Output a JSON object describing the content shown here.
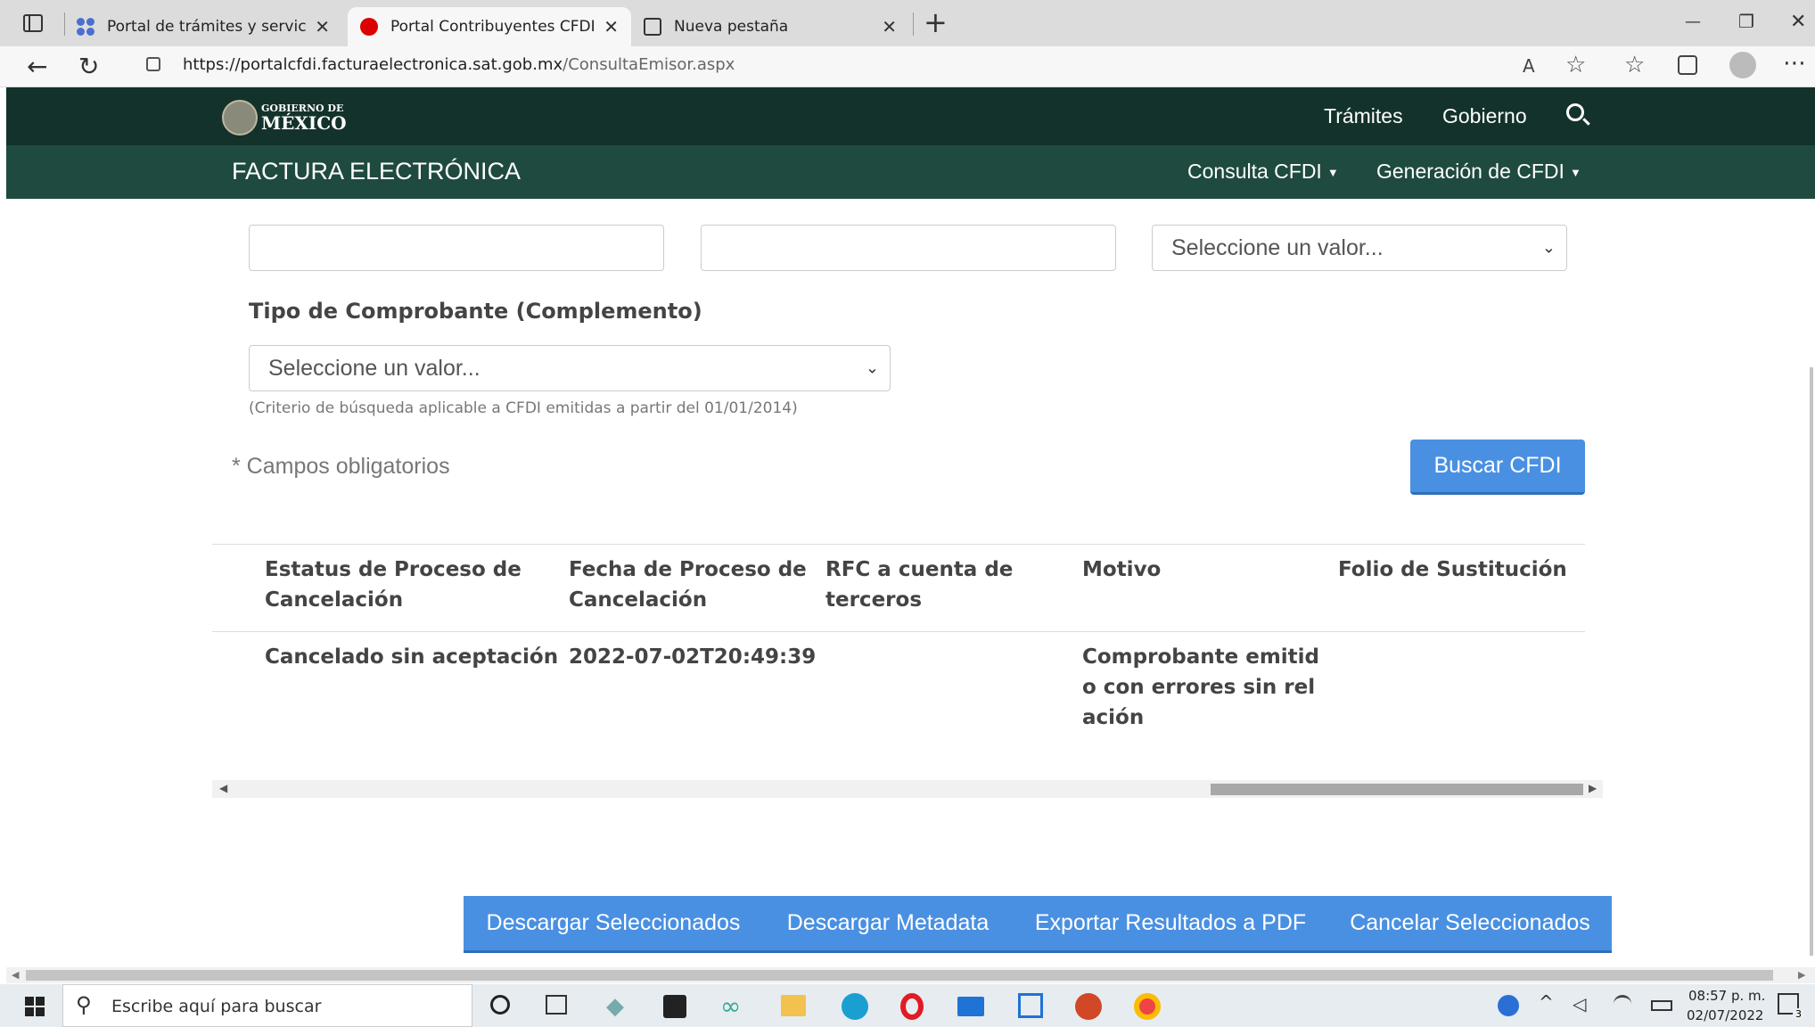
{
  "browser": {
    "tabs": [
      {
        "title": "Portal de trámites y servicios - SAT"
      },
      {
        "title": "Portal Contribuyentes CFDI | Búsqueda"
      },
      {
        "title": "Nueva pestaña"
      }
    ],
    "url_host": "https://portalcfdi.facturaelectronica.sat.gob.mx",
    "url_path": "/ConsultaEmisor.aspx",
    "new_tab": "+",
    "minimize": "—",
    "restore": "❐",
    "close": "✕"
  },
  "gov_header": {
    "logo_top": "GOBIERNO DE",
    "logo_bottom": "MÉXICO",
    "nav": [
      "Trámites",
      "Gobierno"
    ]
  },
  "site_header": {
    "title": "FACTURA ELECTRÓNICA",
    "menus": [
      "Consulta CFDI",
      "Generación de CFDI"
    ]
  },
  "form": {
    "select_placeholder": "Seleccione un valor...",
    "complement_label": "Tipo de Comprobante (Complemento)",
    "complement_placeholder": "Seleccione un valor...",
    "complement_help": "(Criterio de búsqueda aplicable a CFDI emitidas a partir del 01/01/2014)",
    "required_note": "* Campos obligatorios",
    "search_button": "Buscar CFDI"
  },
  "table": {
    "headers": [
      "Estatus de Proceso de Cancelación",
      "Fecha de Proceso de Cancelación",
      "RFC a cuenta de terceros",
      "Motivo",
      "Folio de Sustitución"
    ],
    "row": {
      "status": "Cancelado sin aceptación",
      "date": "2022-07-02T20:49:39",
      "rfc": "",
      "motivo": "Comprobante emitido con errores sin relación",
      "folio": ""
    }
  },
  "actions": [
    "Descargar Seleccionados",
    "Descargar Metadata",
    "Exportar Resultados a PDF",
    "Cancelar Seleccionados"
  ],
  "taskbar": {
    "search_placeholder": "Escribe aquí para buscar",
    "time": "08:57 p. m.",
    "date": "02/07/2022",
    "notif_count": "3"
  },
  "colors": {
    "gov_dark": "#13322b",
    "gov_green": "#1f4a3f",
    "button_blue": "#4a90e2"
  }
}
